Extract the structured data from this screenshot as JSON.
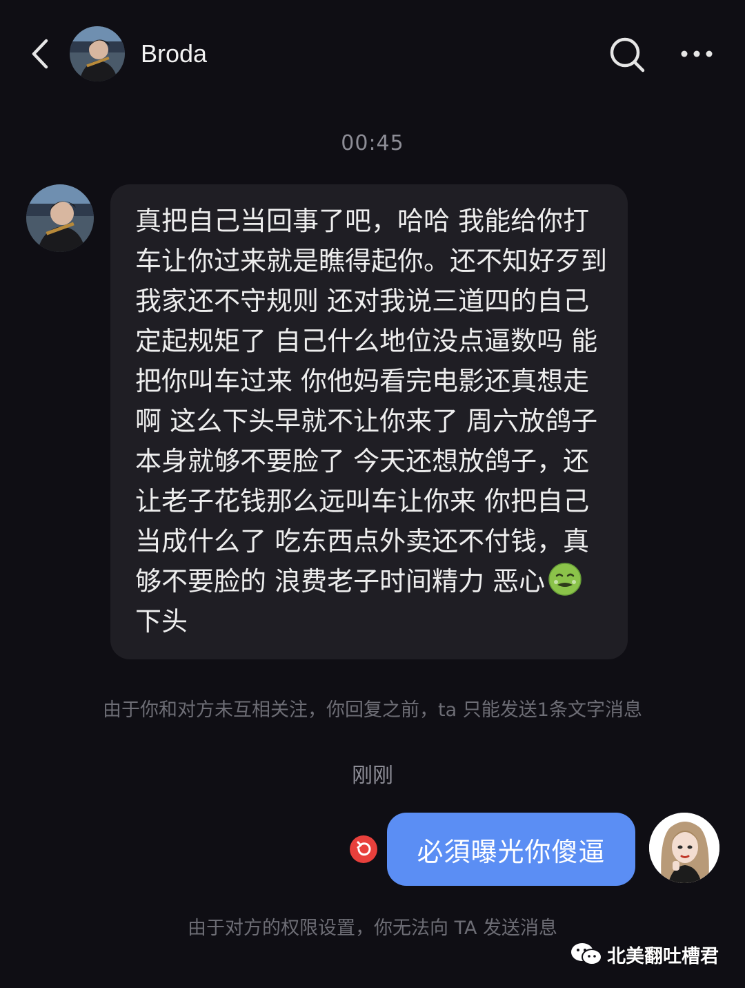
{
  "header": {
    "title": "Broda",
    "back_icon": "chevron-left-icon",
    "search_icon": "search-icon",
    "more_icon": "more-dots-icon"
  },
  "chat": {
    "timestamp_1": "00:45",
    "incoming_message": "真把自己当回事了吧，哈哈 我能给你打车让你过来就是瞧得起你。还不知好歹到我家还不守规则 还对我说三道四的自己定起规矩了 自己什么地位没点逼数吗 能把你叫车过来 你他妈看完电影还真想走啊 这么下头早就不让你来了 周六放鸽子本身就够不要脸了 今天还想放鸽子，还让老子花钱那么远叫车让你来 你把自己当成什么了 吃东西点外卖还不付钱，真够不要脸的 浪费老子时间精力 恶心",
    "incoming_message_tail": "下头",
    "incoming_emoji": "nauseated-face-icon",
    "notice_1": "由于你和对方未互相关注，你回复之前，ta 只能发送1条文字消息",
    "timestamp_2": "刚刚",
    "outgoing_message": "必須曝光你傻逼",
    "resend_icon": "retry-icon",
    "notice_2": "由于对方的权限设置，你无法向 TA 发送消息"
  },
  "watermark": {
    "text": "北美翻吐槽君",
    "icon": "wechat-icon"
  },
  "colors": {
    "background": "#0f0e14",
    "incoming_bubble": "#1f1e24",
    "outgoing_bubble": "#5b8ef4",
    "resend_badge": "#e8403c"
  }
}
